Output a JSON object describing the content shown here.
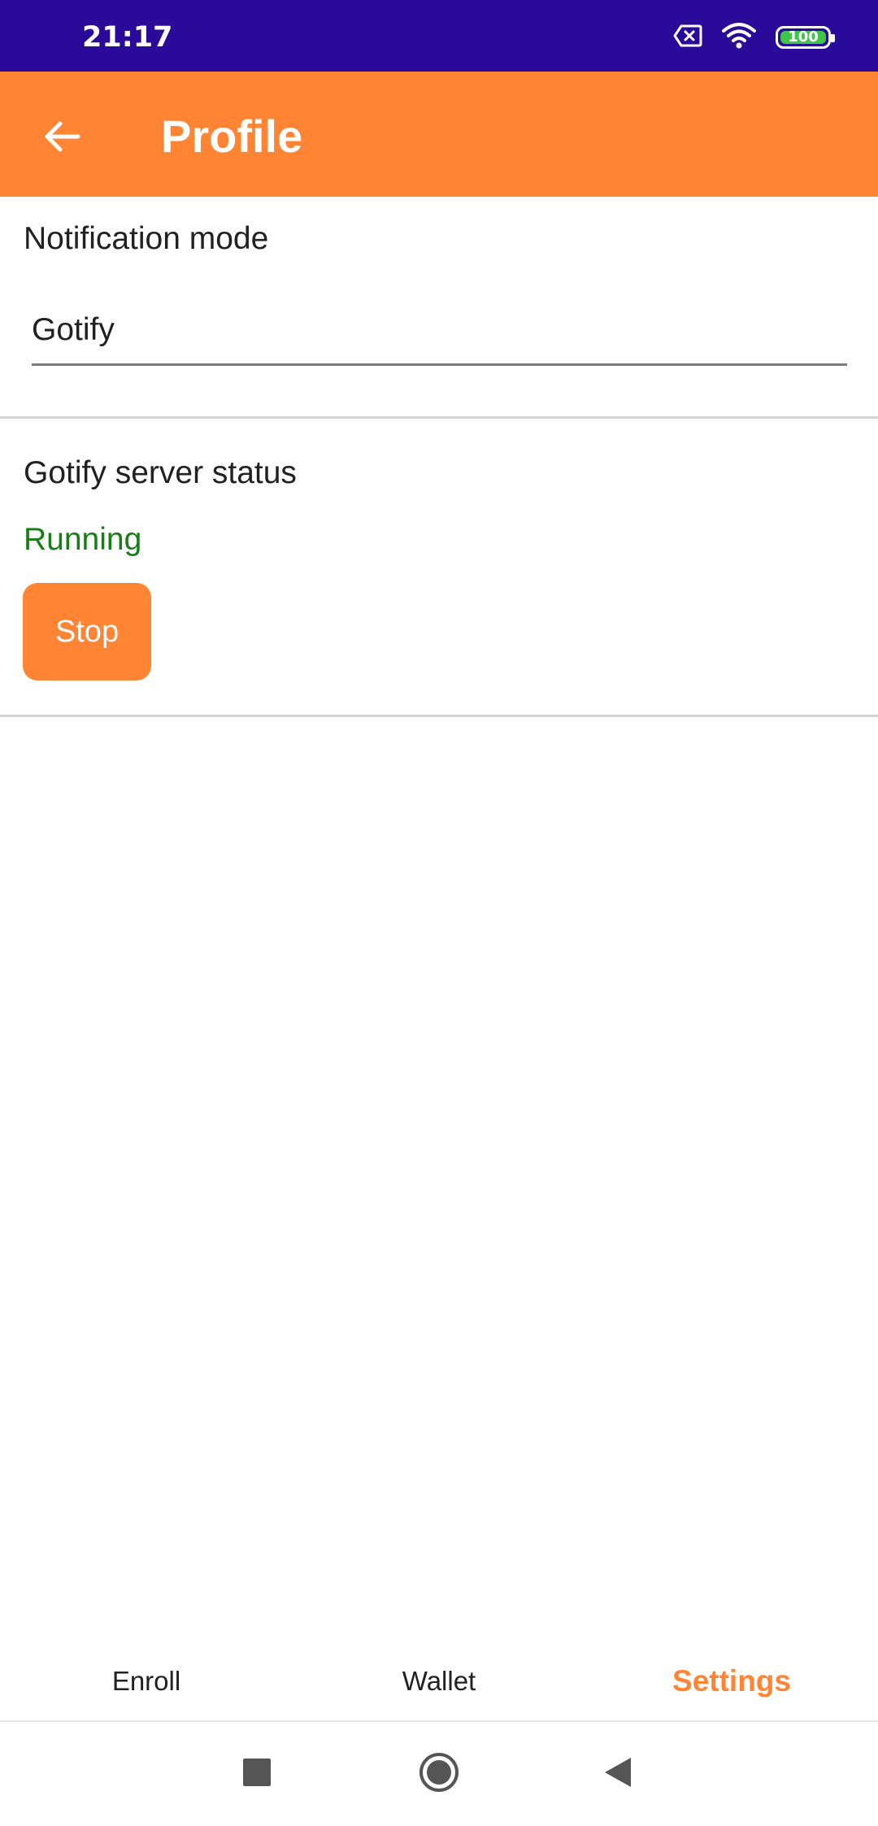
{
  "status_bar": {
    "time": "21:17",
    "battery": "100",
    "battery_level": 1.0,
    "icons": [
      "sim-disabled-icon",
      "wifi-icon",
      "battery-icon"
    ]
  },
  "app_bar": {
    "title": "Profile",
    "back_icon": "arrow-back-icon"
  },
  "notification": {
    "title": "Notification mode",
    "selected_value": "Gotify"
  },
  "gotify": {
    "title": "Gotify server status",
    "status": "Running",
    "stop_label": "Stop"
  },
  "tabs": [
    {
      "label": "Enroll",
      "active": false
    },
    {
      "label": "Wallet",
      "active": false
    },
    {
      "label": "Settings",
      "active": true
    }
  ],
  "nav_bar": {
    "icons": [
      "recents-icon",
      "home-icon",
      "back-icon"
    ]
  },
  "colors": {
    "status_bar": "#2a0a98",
    "accent": "#ff8534",
    "running": "#148014",
    "battery_fill": "#3fc447"
  }
}
